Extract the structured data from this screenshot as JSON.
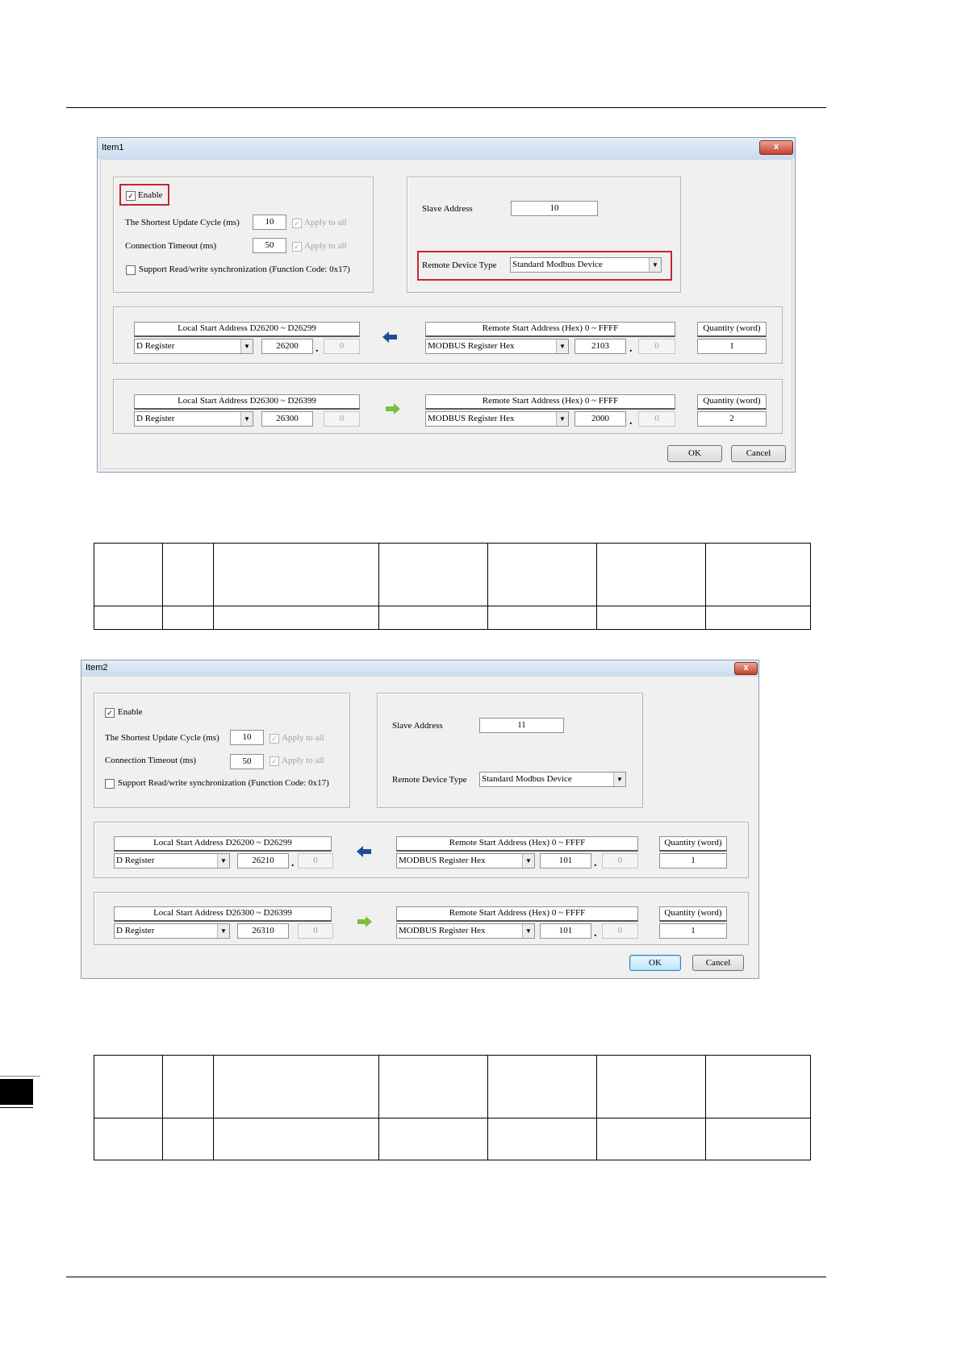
{
  "dialogs": [
    {
      "title": "Item1",
      "close_label": "x",
      "enable_label": "Enable",
      "enable_check": "✓",
      "update_cycle_label": "The Shortest Update Cycle (ms)",
      "update_cycle_value": "10",
      "apply_all_label": "Apply to all",
      "timeout_label": "Connection Timeout (ms)",
      "timeout_value": "50",
      "sync_label": "Support Read/write synchronization (Function Code: 0x17)",
      "slave_address_label": "Slave Address",
      "slave_address_value": "10",
      "device_type_label": "Remote Device Type",
      "device_type_value": "Standard Modbus Device",
      "rows": [
        {
          "local_header": "Local Start Address D26200 ~ D26299",
          "local_type": "D Register",
          "local_value": "26200",
          "local_bit": "0",
          "direction": "read",
          "remote_header": "Remote Start Address (Hex) 0 ~ FFFF",
          "remote_type": "MODBUS Register Hex",
          "remote_value": "2103",
          "remote_bit": "0",
          "qty_header": "Quantity (word)",
          "qty_value": "1"
        },
        {
          "local_header": "Local Start Address D26300 ~ D26399",
          "local_type": "D Register",
          "local_value": "26300",
          "local_bit": "0",
          "direction": "write",
          "remote_header": "Remote Start Address (Hex) 0 ~ FFFF",
          "remote_type": "MODBUS Register Hex",
          "remote_value": "2000",
          "remote_bit": "0",
          "qty_header": "Quantity (word)",
          "qty_value": "2"
        }
      ],
      "ok_label": "OK",
      "cancel_label": "Cancel"
    },
    {
      "title": "Item2",
      "close_label": "x",
      "enable_label": "Enable",
      "enable_check": "✓",
      "update_cycle_label": "The Shortest Update Cycle (ms)",
      "update_cycle_value": "10",
      "apply_all_label": "Apply to all",
      "timeout_label": "Connection Timeout (ms)",
      "timeout_value": "50",
      "sync_label": "Support Read/write synchronization (Function Code: 0x17)",
      "slave_address_label": "Slave Address",
      "slave_address_value": "11",
      "device_type_label": "Remote Device Type",
      "device_type_value": "Standard Modbus Device",
      "rows": [
        {
          "local_header": "Local Start Address D26200 ~ D26299",
          "local_type": "D Register",
          "local_value": "26210",
          "local_bit": "0",
          "direction": "read",
          "remote_header": "Remote Start Address (Hex) 0 ~ FFFF",
          "remote_type": "MODBUS Register Hex",
          "remote_value": "101",
          "remote_bit": "0",
          "qty_header": "Quantity (word)",
          "qty_value": "1"
        },
        {
          "local_header": "Local Start Address D26300 ~ D26399",
          "local_type": "D Register",
          "local_value": "26310",
          "local_bit": "0",
          "direction": "write",
          "remote_header": "Remote Start Address (Hex) 0 ~ FFFF",
          "remote_type": "MODBUS Register Hex",
          "remote_value": "101",
          "remote_bit": "0",
          "qty_header": "Quantity (word)",
          "qty_value": "1"
        }
      ],
      "ok_label": "OK",
      "cancel_label": "Cancel"
    }
  ],
  "colors": {
    "highlight": "#c8252c",
    "read_arrow": "#1f4e96",
    "write_arrow": "#7cbf3a"
  },
  "icons": {
    "read_arrow": "arrow-left-icon",
    "write_arrow": "arrow-right-icon",
    "dropdown": "chevron-down-icon"
  }
}
